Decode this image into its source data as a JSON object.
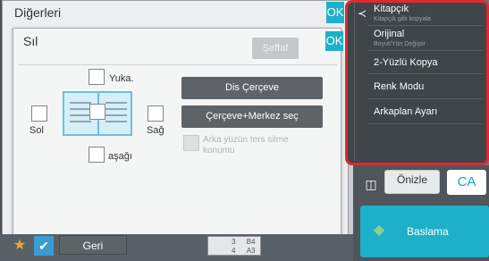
{
  "others_dialog": {
    "title": "Diğerleri",
    "ok_label": "OK"
  },
  "sil_dialog": {
    "title": "Sıl",
    "ok_label": "OK",
    "transparent_label": "Şeffaf",
    "checkbox_labels": {
      "top": "Yuka.",
      "left": "Sol",
      "right": "Sağ",
      "bottom": "aşağı"
    },
    "buttons": {
      "outer_frame": "Dis Çerçeve",
      "frame_center": "Çerçeve+Merkez seç"
    },
    "back_side_option": "Arka yüzün ters silme konumu"
  },
  "bottom_bar": {
    "back_label": "Geri",
    "paper_rows": [
      {
        "tray": "3",
        "size": "B4"
      },
      {
        "tray": "4",
        "size": "A3"
      }
    ]
  },
  "right_menu": {
    "items": [
      {
        "label": "Kitapçık",
        "sub": "Kitapçık gibi kopyala"
      },
      {
        "label": "Orijinal",
        "sub": "Boyut/Yön Değiştir"
      },
      {
        "label": "2-Yüzlü Kopya",
        "sub": ""
      },
      {
        "label": "Renk Modu",
        "sub": ""
      },
      {
        "label": "Arkaplan Ayarı",
        "sub": ""
      }
    ]
  },
  "right_panel": {
    "preview_label": "Önizle",
    "ca_label": "CA",
    "start_label": "Baslama"
  },
  "colors": {
    "accent": "#1db0c8",
    "highlight_border": "#e0282d",
    "dark_button": "#5d6367"
  }
}
